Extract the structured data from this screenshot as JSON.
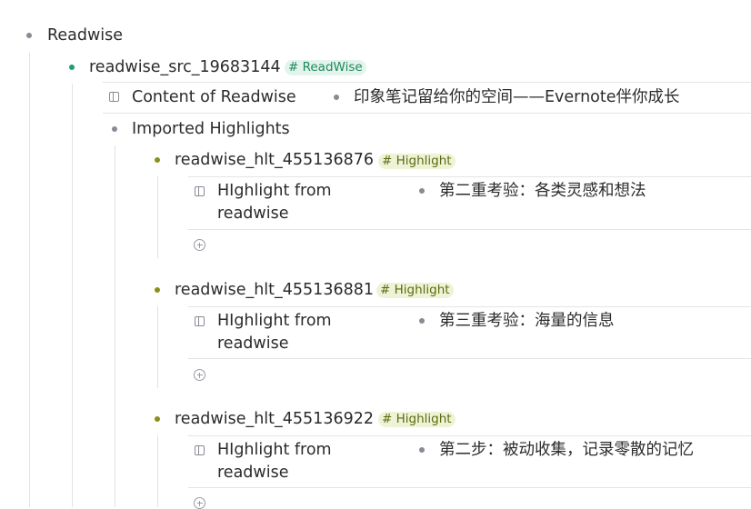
{
  "root": {
    "label": "Readwise"
  },
  "source": {
    "label": "readwise_src_19683144",
    "tag": "# ReadWise"
  },
  "content_field": {
    "name": "Content of Readwise",
    "value": "印象笔记留给你的空间——Evernote伴你成长"
  },
  "imported": {
    "label": "Imported Highlights"
  },
  "highlights": [
    {
      "label": "readwise_hlt_455136876",
      "tag": "# Highlight",
      "field_name_line1": "HIghlight from",
      "field_name_line2": "readwise",
      "value": "第二重考验：各类灵感和想法"
    },
    {
      "label": "readwise_hlt_455136881",
      "tag": "# Highlight",
      "field_name_line1": "HIghlight from",
      "field_name_line2": "readwise",
      "value": "第三重考验：海量的信息"
    },
    {
      "label": "readwise_hlt_455136922",
      "tag": "# Highlight",
      "field_name_line1": "HIghlight from",
      "field_name_line2": "readwise",
      "value": "第二步：被动收集，记录零散的记忆"
    }
  ],
  "colors": {
    "bullet_gray": "#8a8a94",
    "bullet_teal": "#1f9e6e",
    "bullet_olive": "#8a8f1c",
    "tag_readwise_bg": "#e3f4ec",
    "tag_highlight_bg": "#eef3d6"
  }
}
